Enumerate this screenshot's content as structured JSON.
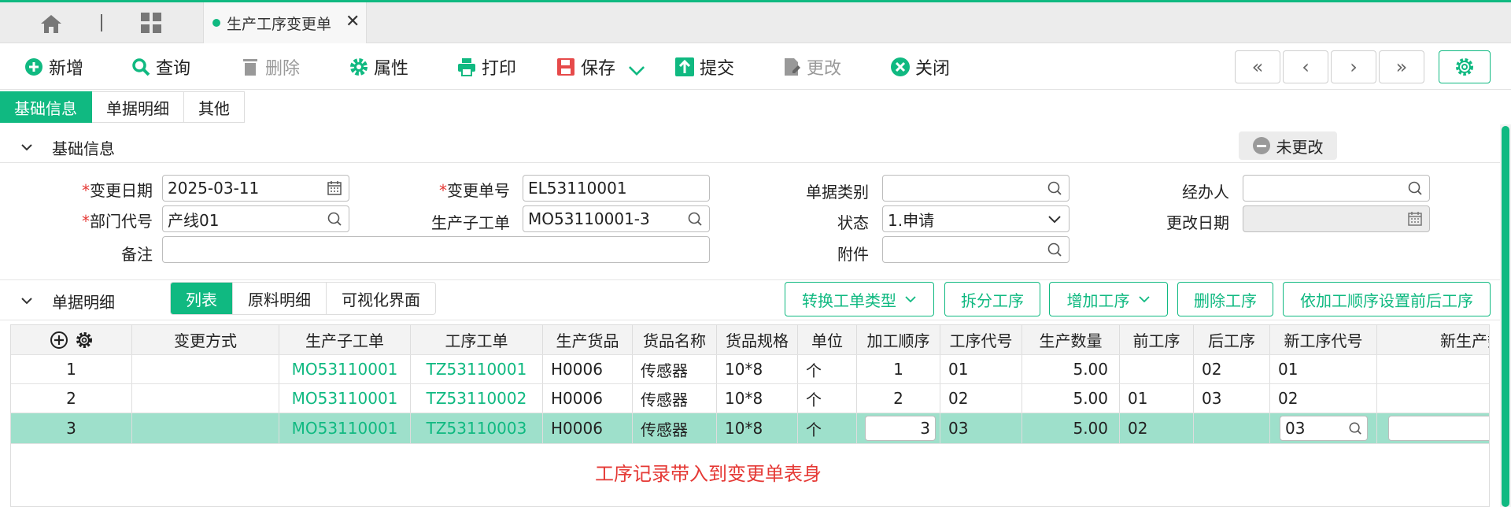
{
  "app_tabs": {
    "active_tab_label": "生产工序变更单"
  },
  "toolbar": {
    "add": "新增",
    "query": "查询",
    "delete": "删除",
    "properties": "属性",
    "print": "打印",
    "save": "保存",
    "submit": "提交",
    "modify": "更改",
    "close": "关闭"
  },
  "page_tabs": [
    "基础信息",
    "单据明细",
    "其他"
  ],
  "basic_section": {
    "title": "基础信息",
    "status_badge": "未更改",
    "fields": {
      "change_date": {
        "label": "变更日期",
        "value": "2025-03-11"
      },
      "change_no": {
        "label": "变更单号",
        "value": "EL53110001"
      },
      "doc_type": {
        "label": "单据类别",
        "value": ""
      },
      "handler": {
        "label": "经办人",
        "value": ""
      },
      "dept_code": {
        "label": "部门代号",
        "value": "产线01"
      },
      "sub_order": {
        "label": "生产子工单",
        "value": "MO53110001-3"
      },
      "status": {
        "label": "状态",
        "value": "1.申请"
      },
      "modify_date": {
        "label": "更改日期",
        "value": ""
      },
      "remark": {
        "label": "备注",
        "value": ""
      },
      "attachment": {
        "label": "附件",
        "value": ""
      }
    }
  },
  "detail_section": {
    "title": "单据明细",
    "sub_tabs": [
      "列表",
      "原料明细",
      "可视化界面"
    ],
    "buttons": {
      "convert_type": "转换工单类型",
      "split": "拆分工序",
      "add_process": "增加工序",
      "delete_process": "删除工序",
      "set_order": "依加工顺序设置前后工序"
    },
    "columns": [
      "变更方式",
      "生产子工单",
      "工序工单",
      "生产货品",
      "货品名称",
      "货品规格",
      "单位",
      "加工顺序",
      "工序代号",
      "生产数量",
      "前工序",
      "后工序",
      "新工序代号",
      "新生产数"
    ],
    "rows": [
      {
        "no": "1",
        "change_mode": "",
        "sub_order": "MO53110001",
        "process_order": "TZ53110001",
        "product": "H0006",
        "name": "传感器",
        "spec": "10*8",
        "unit": "个",
        "seq": "1",
        "process_code": "01",
        "qty": "5.00",
        "prev": "",
        "next": "02",
        "new_code": "01",
        "new_qty": ""
      },
      {
        "no": "2",
        "change_mode": "",
        "sub_order": "MO53110001",
        "process_order": "TZ53110002",
        "product": "H0006",
        "name": "传感器",
        "spec": "10*8",
        "unit": "个",
        "seq": "2",
        "process_code": "02",
        "qty": "5.00",
        "prev": "01",
        "next": "03",
        "new_code": "02",
        "new_qty": ""
      },
      {
        "no": "3",
        "change_mode": "",
        "sub_order": "MO53110001",
        "process_order": "TZ53110003",
        "product": "H0006",
        "name": "传感器",
        "spec": "10*8",
        "unit": "个",
        "seq": "3",
        "process_code": "03",
        "qty": "5.00",
        "prev": "02",
        "next": "",
        "new_code": "03",
        "new_qty": ""
      }
    ],
    "hint": "工序记录带入到变更单表身"
  },
  "colors": {
    "accent": "#10b981",
    "selected_row": "#9ee0cb",
    "hint": "#e53935"
  }
}
